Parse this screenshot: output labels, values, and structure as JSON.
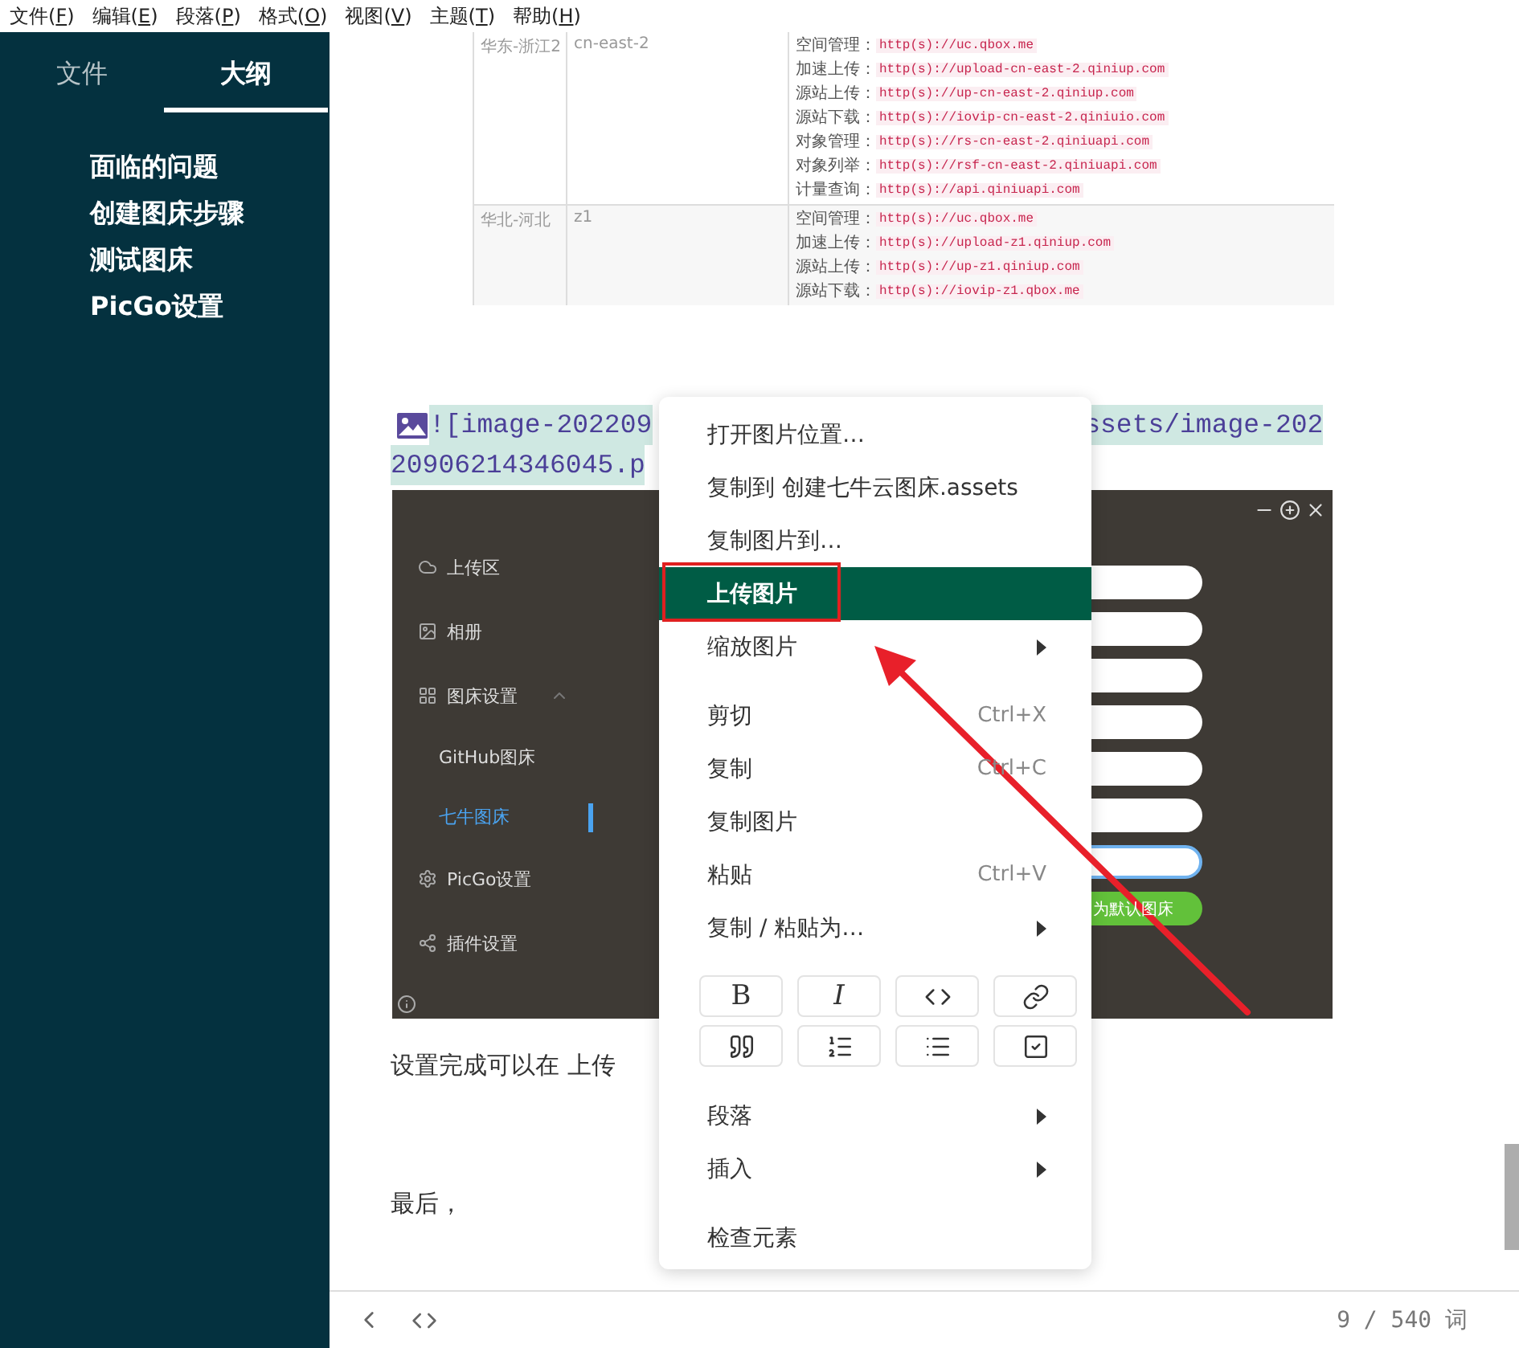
{
  "menubar": [
    "文件(F)",
    "编辑(E)",
    "段落(P)",
    "格式(O)",
    "视图(V)",
    "主题(T)",
    "帮助(H)"
  ],
  "sidebar": {
    "tabs": [
      {
        "label": "文件",
        "selected": false
      },
      {
        "label": "大纲",
        "selected": true
      }
    ],
    "outline": [
      "面临的问题",
      "创建图床步骤",
      "测试图床",
      "PicGo设置"
    ]
  },
  "document": {
    "table_image": {
      "rows": [
        {
          "region": "华东-浙江2",
          "code": "cn-east-2",
          "endpoints": [
            {
              "label": "空间管理：",
              "url": "http(s)://uc.qbox.me"
            },
            {
              "label": "加速上传：",
              "url": "http(s)://upload-cn-east-2.qiniup.com"
            },
            {
              "label": "源站上传：",
              "url": "http(s)://up-cn-east-2.qiniup.com"
            },
            {
              "label": "源站下载：",
              "url": "http(s)://iovip-cn-east-2.qiniuio.com"
            },
            {
              "label": "对象管理：",
              "url": "http(s)://rs-cn-east-2.qiniuapi.com"
            },
            {
              "label": "对象列举：",
              "url": "http(s)://rsf-cn-east-2.qiniuapi.com"
            },
            {
              "label": "计量查询：",
              "url": "http(s)://api.qiniuapi.com"
            }
          ]
        },
        {
          "region": "华北-河北",
          "code": "z1",
          "endpoints": [
            {
              "label": "空间管理：",
              "url": "http(s)://uc.qbox.me"
            },
            {
              "label": "加速上传：",
              "url": "http(s)://upload-z1.qiniup.com"
            },
            {
              "label": "源站上传：",
              "url": "http(s)://up-z1.qiniup.com"
            },
            {
              "label": "源站下载：",
              "url": "http(s)://iovip-z1.qbox.me"
            }
          ]
        }
      ]
    },
    "image_link": {
      "line_1_start": "![image-202209",
      "line_1_end": "ssets/image-202",
      "line_2": "20906214346045.p"
    },
    "picgo_image": {
      "nav": [
        {
          "kind": "item",
          "label": "上传区",
          "selected": false
        },
        {
          "kind": "item",
          "label": "相册",
          "selected": false
        },
        {
          "kind": "group",
          "label": "图床设置",
          "selected": false
        },
        {
          "kind": "subitem",
          "label": "GitHub图床",
          "selected": false
        },
        {
          "kind": "subitem",
          "label": "七牛图床",
          "selected": true
        },
        {
          "kind": "item",
          "label": "PicGo设置",
          "selected": false
        },
        {
          "kind": "item",
          "label": "插件设置",
          "selected": false
        }
      ],
      "fields": [
        {
          "focused": false
        },
        {
          "focused": false
        },
        {
          "focused": false
        },
        {
          "focused": false
        },
        {
          "focused": false
        },
        {
          "focused": false
        },
        {
          "focused": true
        }
      ],
      "default_button": "为默认图床"
    },
    "paragraph_1": "设置完成可以在 上传",
    "paragraph_2": "最后，"
  },
  "context_menu": {
    "items": [
      {
        "kind": "item",
        "label": "打开图片位置…",
        "selected": false,
        "boxed": false,
        "submenu": false
      },
      {
        "kind": "item",
        "label": "复制到 创建七牛云图床.assets",
        "selected": false,
        "boxed": false,
        "submenu": false
      },
      {
        "kind": "item",
        "label": "复制图片到…",
        "selected": false,
        "boxed": false,
        "submenu": false
      },
      {
        "kind": "item",
        "label": "上传图片",
        "selected": true,
        "boxed": true,
        "submenu": false
      },
      {
        "kind": "item",
        "label": "缩放图片",
        "selected": false,
        "boxed": false,
        "submenu": true
      },
      {
        "kind": "separator"
      },
      {
        "kind": "item",
        "label": "剪切",
        "shortcut": "Ctrl+X",
        "selected": false,
        "boxed": false,
        "submenu": false
      },
      {
        "kind": "item",
        "label": "复制",
        "shortcut": "Ctrl+C",
        "selected": false,
        "boxed": false,
        "submenu": false
      },
      {
        "kind": "item",
        "label": "复制图片",
        "selected": false,
        "boxed": false,
        "submenu": false
      },
      {
        "kind": "item",
        "label": "粘贴",
        "shortcut": "Ctrl+V",
        "selected": false,
        "boxed": false,
        "submenu": false
      },
      {
        "kind": "item",
        "label": "复制 / 粘贴为…",
        "selected": false,
        "boxed": false,
        "submenu": true
      },
      {
        "kind": "buttons",
        "buttons": [
          {
            "kind": "text",
            "label": "B"
          },
          {
            "kind": "text",
            "label": "I"
          },
          {
            "kind": "icon"
          },
          {
            "kind": "icon"
          },
          {
            "kind": "icon"
          },
          {
            "kind": "icon"
          },
          {
            "kind": "icon"
          },
          {
            "kind": "icon"
          }
        ]
      },
      {
        "kind": "item",
        "label": "段落",
        "selected": false,
        "boxed": false,
        "submenu": true
      },
      {
        "kind": "item",
        "label": "插入",
        "selected": false,
        "boxed": false,
        "submenu": true
      },
      {
        "kind": "separator"
      },
      {
        "kind": "item",
        "label": "检查元素",
        "selected": false,
        "boxed": false,
        "submenu": false
      }
    ]
  },
  "status_bar": {
    "word_count": "9 / 540 词"
  }
}
